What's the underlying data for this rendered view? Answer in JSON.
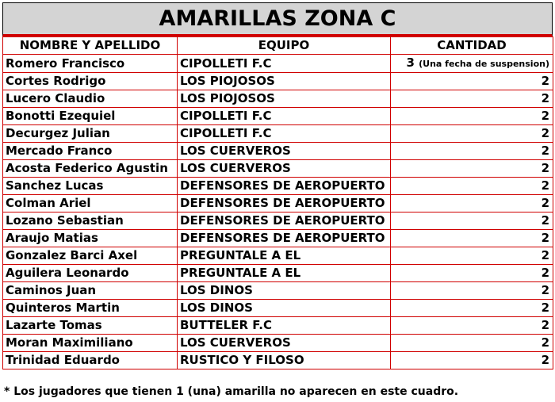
{
  "title": "AMARILLAS ZONA C",
  "headers": {
    "name": "NOMBRE Y APELLIDO",
    "team": "EQUIPO",
    "quantity": "CANTIDAD"
  },
  "rows": [
    {
      "name": "Romero Francisco",
      "team": "CIPOLLETI F.C",
      "quantity": "3",
      "note": "(Una fecha de suspension)"
    },
    {
      "name": "Cortes Rodrigo",
      "team": "LOS PIOJOSOS",
      "quantity": "2"
    },
    {
      "name": "Lucero Claudio",
      "team": "LOS PIOJOSOS",
      "quantity": "2"
    },
    {
      "name": "Bonotti Ezequiel",
      "team": "CIPOLLETI F.C",
      "quantity": "2"
    },
    {
      "name": "Decurgez Julian",
      "team": "CIPOLLETI F.C",
      "quantity": "2"
    },
    {
      "name": "Mercado Franco",
      "team": "LOS CUERVEROS",
      "quantity": "2"
    },
    {
      "name": "Acosta Federico Agustin",
      "team": "LOS CUERVEROS",
      "quantity": "2"
    },
    {
      "name": "Sanchez Lucas",
      "team": "DEFENSORES DE AEROPUERTO",
      "quantity": "2"
    },
    {
      "name": "Colman Ariel",
      "team": "DEFENSORES DE AEROPUERTO",
      "quantity": "2"
    },
    {
      "name": "Lozano Sebastian",
      "team": "DEFENSORES DE AEROPUERTO",
      "quantity": "2"
    },
    {
      "name": "Araujo Matias",
      "team": "DEFENSORES DE AEROPUERTO",
      "quantity": "2"
    },
    {
      "name": "Gonzalez Barci Axel",
      "team": "PREGUNTALE A EL",
      "quantity": "2"
    },
    {
      "name": "Aguilera Leonardo",
      "team": "PREGUNTALE A EL",
      "quantity": "2"
    },
    {
      "name": "Caminos Juan",
      "team": "LOS DINOS",
      "quantity": "2"
    },
    {
      "name": "Quinteros Martin",
      "team": "LOS DINOS",
      "quantity": "2"
    },
    {
      "name": "Lazarte Tomas",
      "team": "BUTTELER F.C",
      "quantity": "2"
    },
    {
      "name": "Moran Maximiliano",
      "team": "LOS CUERVEROS",
      "quantity": "2"
    },
    {
      "name": "Trinidad Eduardo",
      "team": "RUSTICO Y FILOSO",
      "quantity": "2"
    }
  ],
  "footnote": "* Los jugadores que tienen 1 (una) amarilla no aparecen en este cuadro.",
  "colors": {
    "border": "#d00000",
    "title_bg": "#d4d4d4"
  }
}
